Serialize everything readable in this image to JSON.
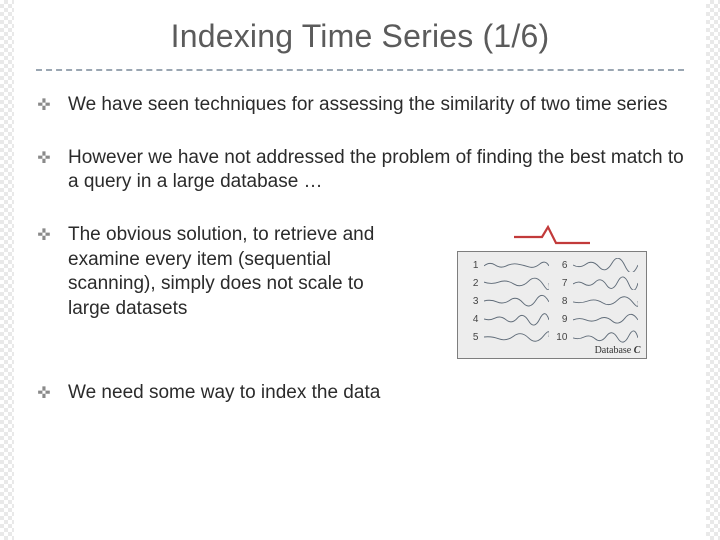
{
  "title": "Indexing Time Series (1/6)",
  "bullets": [
    "We have seen techniques for assessing the similarity of two time series",
    "However we have not addressed the problem of finding the best match to a query in a large database …",
    "The obvious solution, to retrieve and examine every item (sequential scanning), simply does not scale to large datasets",
    "We need some way to index the data"
  ],
  "figure": {
    "query_color": "#c23a3a",
    "wave_color": "#5f6b78",
    "database_label_prefix": "Database ",
    "database_label_suffix": "C",
    "rows": [
      {
        "left_num": "1",
        "right_num": "6"
      },
      {
        "left_num": "2",
        "right_num": "7"
      },
      {
        "left_num": "3",
        "right_num": "8"
      },
      {
        "left_num": "4",
        "right_num": "9"
      },
      {
        "left_num": "5",
        "right_num": "10"
      }
    ]
  }
}
